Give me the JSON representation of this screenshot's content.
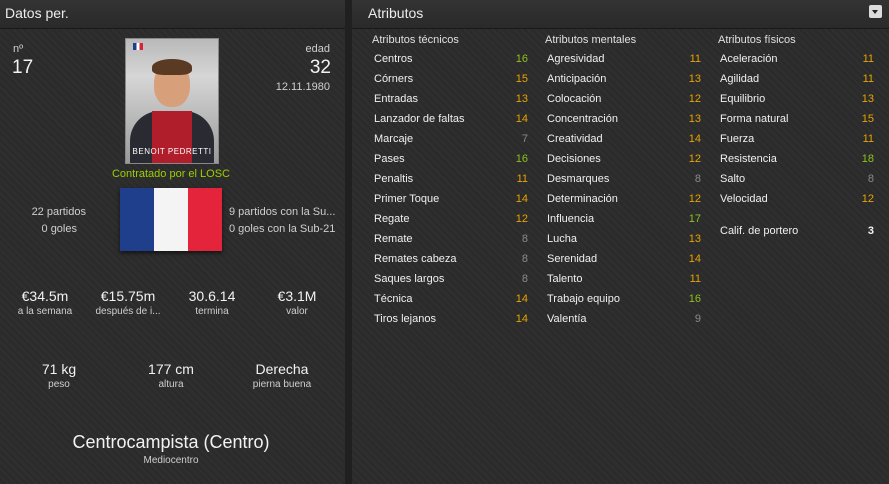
{
  "left_panel": {
    "title": "Datos per.",
    "number_label": "nº",
    "number_value": "17",
    "age_label": "edad",
    "age_value": "32",
    "birth_date": "12.11.1980",
    "photo_name": "BENOIT PEDRETTI",
    "contract_text": "Contratado por el LOSC",
    "club_matches": "22 partidos",
    "club_goals": "0 goles",
    "intl_matches": "9 partidos con la Su...",
    "intl_goals": "0 goles con la Sub-21",
    "finance": [
      {
        "value": "€34.5m",
        "label": "a la semana"
      },
      {
        "value": "€15.75m",
        "label": "después de i..."
      },
      {
        "value": "30.6.14",
        "label": "termina"
      },
      {
        "value": "€3.1M",
        "label": "valor"
      }
    ],
    "physical": [
      {
        "value": "71 kg",
        "label": "peso"
      },
      {
        "value": "177 cm",
        "label": "altura"
      },
      {
        "value": "Derecha",
        "label": "pierna buena"
      }
    ],
    "position": "Centrocampista (Centro)",
    "role": "Mediocentro",
    "flag_colors": [
      "#1f3f8c",
      "#f4f4f4",
      "#e3243b"
    ]
  },
  "right_panel": {
    "title": "Atributos",
    "value_colors": {
      "green": "#8dc21f",
      "orange": "#e8a400",
      "grey": "#8a8a8a"
    },
    "technical": {
      "heading": "Atributos técnicos",
      "items": [
        {
          "name": "Centros",
          "value": "16",
          "tone": "green"
        },
        {
          "name": "Córners",
          "value": "15",
          "tone": "orange"
        },
        {
          "name": "Entradas",
          "value": "13",
          "tone": "orange"
        },
        {
          "name": "Lanzador de faltas",
          "value": "14",
          "tone": "orange"
        },
        {
          "name": "Marcaje",
          "value": "7",
          "tone": "grey"
        },
        {
          "name": "Pases",
          "value": "16",
          "tone": "green"
        },
        {
          "name": "Penaltis",
          "value": "11",
          "tone": "orange"
        },
        {
          "name": "Primer Toque",
          "value": "14",
          "tone": "orange"
        },
        {
          "name": "Regate",
          "value": "12",
          "tone": "orange"
        },
        {
          "name": "Remate",
          "value": "8",
          "tone": "grey"
        },
        {
          "name": "Remates cabeza",
          "value": "8",
          "tone": "grey"
        },
        {
          "name": "Saques largos",
          "value": "8",
          "tone": "grey"
        },
        {
          "name": "Técnica",
          "value": "14",
          "tone": "orange"
        },
        {
          "name": "Tiros lejanos",
          "value": "14",
          "tone": "orange"
        }
      ]
    },
    "mental": {
      "heading": "Atributos mentales",
      "items": [
        {
          "name": "Agresividad",
          "value": "11",
          "tone": "orange"
        },
        {
          "name": "Anticipación",
          "value": "13",
          "tone": "orange"
        },
        {
          "name": "Colocación",
          "value": "12",
          "tone": "orange"
        },
        {
          "name": "Concentración",
          "value": "13",
          "tone": "orange"
        },
        {
          "name": "Creatividad",
          "value": "14",
          "tone": "orange"
        },
        {
          "name": "Decisiones",
          "value": "12",
          "tone": "orange"
        },
        {
          "name": "Desmarques",
          "value": "8",
          "tone": "grey"
        },
        {
          "name": "Determinación",
          "value": "12",
          "tone": "orange"
        },
        {
          "name": "Influencia",
          "value": "17",
          "tone": "green"
        },
        {
          "name": "Lucha",
          "value": "13",
          "tone": "orange"
        },
        {
          "name": "Serenidad",
          "value": "14",
          "tone": "orange"
        },
        {
          "name": "Talento",
          "value": "11",
          "tone": "orange"
        },
        {
          "name": "Trabajo equipo",
          "value": "16",
          "tone": "green"
        },
        {
          "name": "Valentía",
          "value": "9",
          "tone": "grey"
        }
      ]
    },
    "physical": {
      "heading": "Atributos físicos",
      "items": [
        {
          "name": "Aceleración",
          "value": "11",
          "tone": "orange"
        },
        {
          "name": "Agilidad",
          "value": "11",
          "tone": "orange"
        },
        {
          "name": "Equilibrio",
          "value": "13",
          "tone": "orange"
        },
        {
          "name": "Forma natural",
          "value": "15",
          "tone": "orange"
        },
        {
          "name": "Fuerza",
          "value": "11",
          "tone": "orange"
        },
        {
          "name": "Resistencia",
          "value": "18",
          "tone": "green"
        },
        {
          "name": "Salto",
          "value": "8",
          "tone": "grey"
        },
        {
          "name": "Velocidad",
          "value": "12",
          "tone": "orange"
        }
      ],
      "goalkeeper_label": "Calif. de portero",
      "goalkeeper_value": "3"
    }
  }
}
